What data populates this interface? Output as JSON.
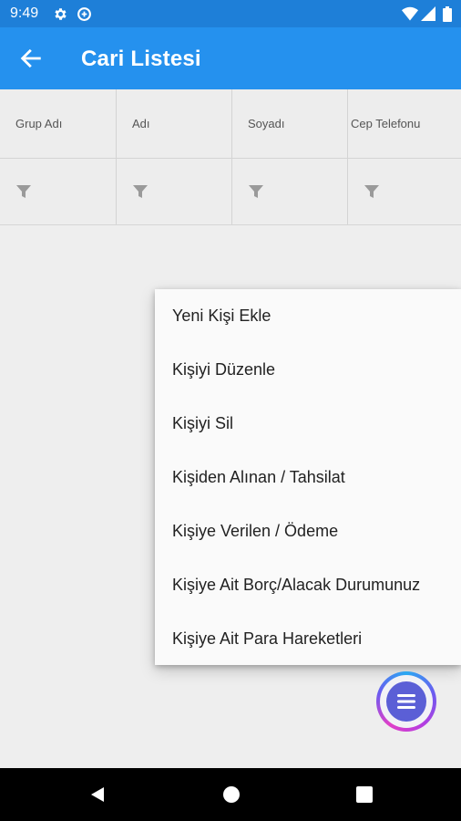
{
  "status_bar": {
    "time": "9:49",
    "icons": [
      "settings-icon",
      "data-saver-icon",
      "wifi-icon",
      "signal-icon",
      "battery-icon"
    ]
  },
  "app_bar": {
    "title": "Cari Listesi",
    "back_icon": "arrow-left-icon",
    "color": "#2591ee"
  },
  "grid": {
    "columns": [
      {
        "label": "Grup Adı"
      },
      {
        "label": "Adı"
      },
      {
        "label": "Soyadı"
      },
      {
        "label": "Cep Telefonu"
      }
    ],
    "filter_icon": "filter-icon"
  },
  "context_menu": {
    "items": [
      "Yeni Kişi Ekle",
      "Kişiyi Düzenle",
      "Kişiyi Sil",
      "Kişiden Alınan / Tahsilat",
      "Kişiye Verilen / Ödeme",
      "Kişiye Ait Borç/Alacak Durumunuz",
      "Kişiye Ait Para Hareketleri"
    ]
  },
  "fab": {
    "icon": "menu-icon"
  },
  "nav_bar": {
    "icons": [
      "back-triangle-icon",
      "home-circle-icon",
      "recents-square-icon"
    ]
  }
}
